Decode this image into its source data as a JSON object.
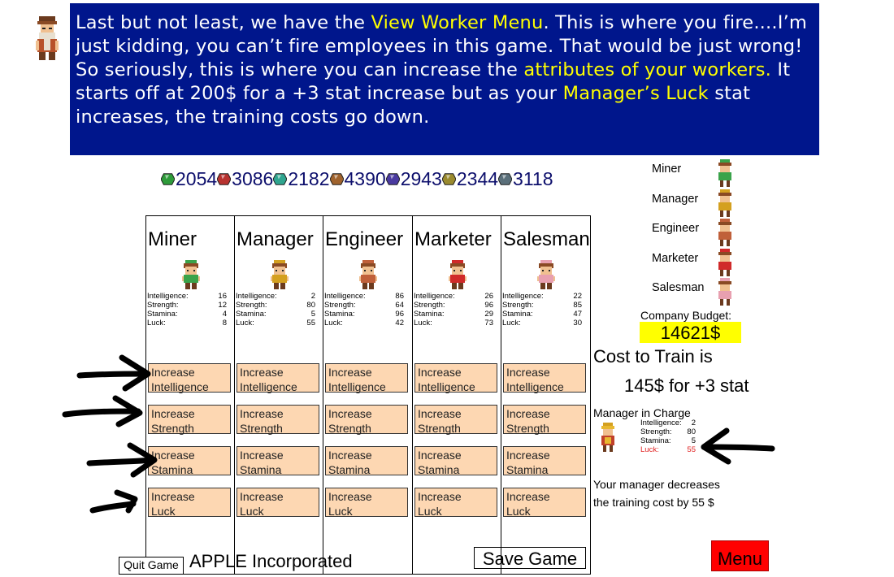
{
  "dialog": {
    "segments": [
      {
        "text": "Last but not least, we have the ",
        "hl": false
      },
      {
        "text": "View Worker Menu",
        "hl": true
      },
      {
        "text": ". This is where you fire....I’m just kidding, you can’t fire employees in this game. That would be just wrong! So seriously, this is where you can increase the ",
        "hl": false
      },
      {
        "text": "attributes of your workers.",
        "hl": true
      },
      {
        "text": " It starts off at 200$ for a +3 stat increase but as your ",
        "hl": false
      },
      {
        "text": "Manager’s Luck",
        "hl": true
      },
      {
        "text": " stat increases, the training costs go down.",
        "hl": false
      }
    ],
    "highlight_color": "#ffff00",
    "background": "#00168c"
  },
  "resources": [
    {
      "icon": "green-gem-icon",
      "color": "#2e9b3a",
      "value": "2054"
    },
    {
      "icon": "red-gem-icon",
      "color": "#b8322f",
      "value": "3086"
    },
    {
      "icon": "teal-gem-icon",
      "color": "#2fa58f",
      "value": "2182"
    },
    {
      "icon": "brown-gem-icon",
      "color": "#a0632d",
      "value": "4390"
    },
    {
      "icon": "purple-gem-icon",
      "color": "#4a3aa0",
      "value": "2943"
    },
    {
      "icon": "olive-gem-icon",
      "color": "#9a8a2e",
      "value": "2344"
    },
    {
      "icon": "slate-gem-icon",
      "color": "#5a6f7a",
      "value": "3118"
    }
  ],
  "workers": [
    {
      "name": "Miner",
      "sprite_color": "#3aa34a",
      "stats": {
        "intelligence": "16",
        "strength": "12",
        "stamina": "4",
        "luck": "8"
      }
    },
    {
      "name": "Manager",
      "sprite_color": "#d4a020",
      "stats": {
        "intelligence": "2",
        "strength": "80",
        "stamina": "5",
        "luck": "55"
      }
    },
    {
      "name": "Engineer",
      "sprite_color": "#c0603a",
      "stats": {
        "intelligence": "86",
        "strength": "64",
        "stamina": "96",
        "luck": "42"
      }
    },
    {
      "name": "Marketer",
      "sprite_color": "#d02a2a",
      "stats": {
        "intelligence": "26",
        "strength": "96",
        "stamina": "29",
        "luck": "73"
      }
    },
    {
      "name": "Salesman",
      "sprite_color": "#e8a0b0",
      "stats": {
        "intelligence": "22",
        "strength": "85",
        "stamina": "47",
        "luck": "30"
      }
    }
  ],
  "stat_labels": {
    "intelligence": "Intelligence:",
    "strength": "Strength:",
    "stamina": "Stamina:",
    "luck": "Luck:"
  },
  "buttons": {
    "increase": "Increase",
    "intelligence": "Intelligence",
    "strength": "Strength",
    "stamina": "Stamina",
    "luck": "Luck"
  },
  "legend": [
    "Miner",
    "Manager",
    "Engineer",
    "Marketer",
    "Salesman"
  ],
  "budget": {
    "label": "Company Budget:",
    "value": "14621$"
  },
  "cost": {
    "line1": "Cost to Train is",
    "line2": "145$ for +3 stat"
  },
  "manager_in_charge": {
    "label": "Manager in Charge",
    "stats": {
      "intelligence": "2",
      "strength": "80",
      "stamina": "5",
      "luck": "55"
    },
    "luck_color": "#e02020"
  },
  "note": {
    "line1": "Your manager decreases",
    "line2": "the training cost by 55 $"
  },
  "footer": {
    "quit": "Quit Game",
    "company": "APPLE Incorporated",
    "save": "Save Game",
    "menu": "Menu"
  }
}
